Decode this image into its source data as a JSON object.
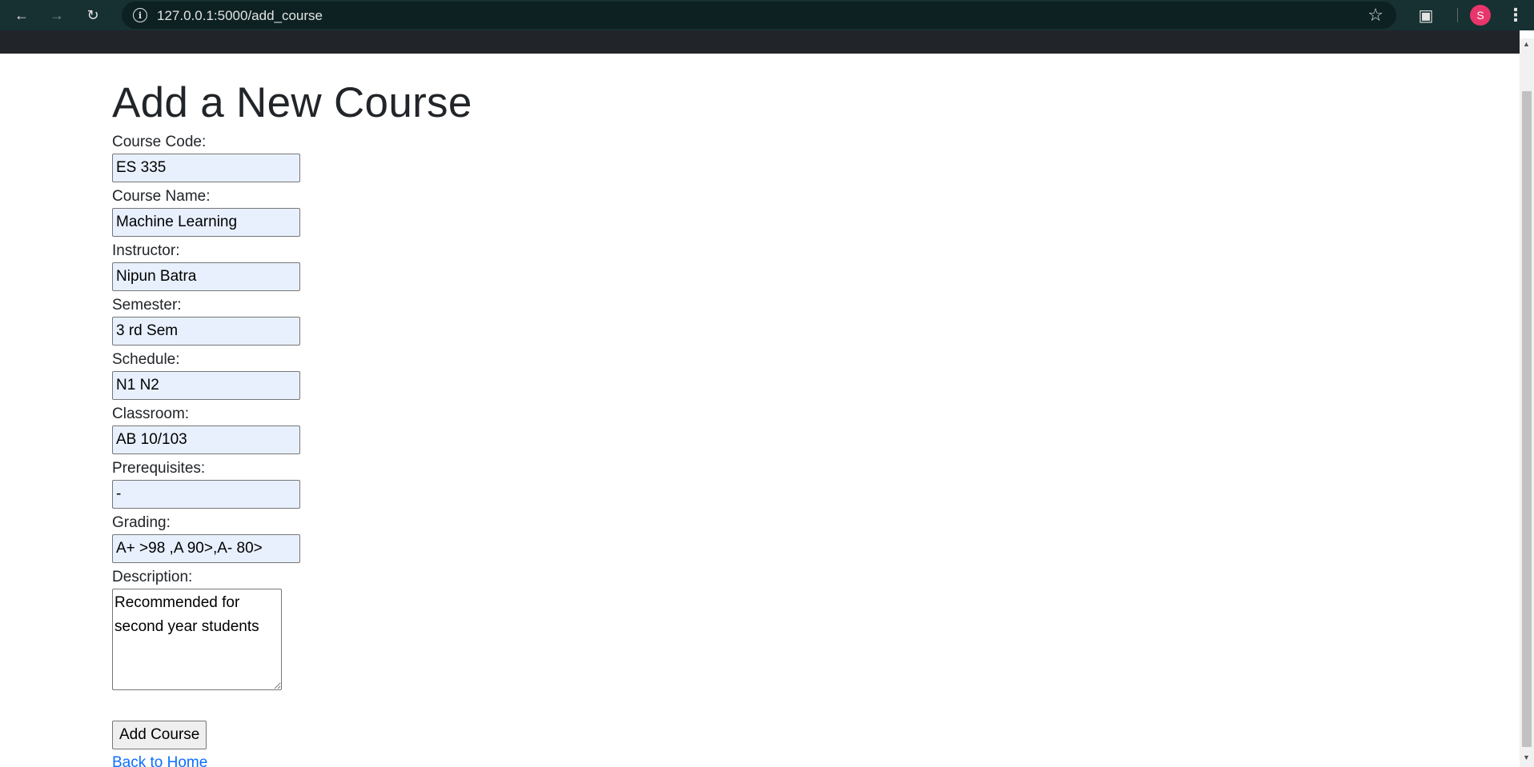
{
  "browser": {
    "url": "127.0.0.1:5000/add_course",
    "avatar_letter": "S"
  },
  "page": {
    "title": "Add a New Course"
  },
  "form": {
    "course_code": {
      "label": "Course Code:",
      "value": "ES 335"
    },
    "course_name": {
      "label": "Course Name:",
      "value": "Machine Learning"
    },
    "instructor": {
      "label": "Instructor:",
      "value": "Nipun Batra"
    },
    "semester": {
      "label": "Semester:",
      "value": "3 rd Sem"
    },
    "schedule": {
      "label": "Schedule:",
      "value": "N1 N2"
    },
    "classroom": {
      "label": "Classroom:",
      "value": "AB 10/103"
    },
    "prerequisites": {
      "label": "Prerequisites:",
      "value": "-"
    },
    "grading": {
      "label": "Grading:",
      "value": "A+ >98 ,A 90>,A- 80>"
    },
    "description": {
      "label": "Description:",
      "value": "Recommended for second year students"
    },
    "submit_label": "Add Course"
  },
  "links": {
    "back_home": "Back to Home"
  },
  "colors": {
    "toolbar": "#173032",
    "navbar": "#212529",
    "autofill": "#e8f0fe",
    "link": "#0d6efd",
    "avatar": "#e8356b"
  }
}
